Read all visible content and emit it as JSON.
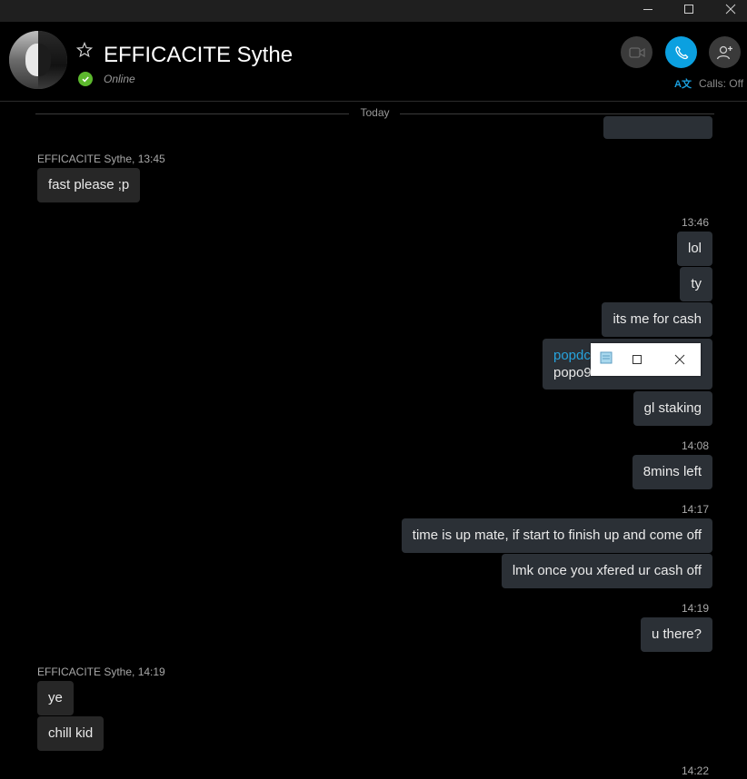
{
  "window": {
    "minimize_icon": "minimize-icon",
    "maximize_icon": "maximize-icon",
    "close_icon": "close-icon"
  },
  "header": {
    "contact_name": "EFFICACITE Sythe",
    "status": "Online",
    "favorite_icon": "star-icon",
    "video_icon": "video-camera-icon",
    "call_icon": "phone-icon",
    "add_people_icon": "add-person-icon",
    "translator_label": "A文",
    "calls_label": "Calls: Off",
    "colors": {
      "call_button": "#0ba0e0",
      "online": "#5cb82d"
    }
  },
  "conversation": {
    "day_divider": "Today",
    "messages": [
      {
        "text": ""
      },
      {
        "sender": "EFFICACITE Sythe, 13:45",
        "text": "fast please ;p"
      },
      {
        "time": "13:46",
        "text": "lol"
      },
      {
        "text": "ty"
      },
      {
        "text": "its me for cash"
      },
      {
        "link": "popdc",
        "text": "popo9"
      },
      {
        "text": "gl staking"
      },
      {
        "time": "14:08",
        "text": "8mins left"
      },
      {
        "time": "14:17",
        "text": "time is up mate, if start to finish up and come off"
      },
      {
        "text": "lmk once you xfered ur cash off"
      },
      {
        "time": "14:19",
        "text": "u there?"
      },
      {
        "sender": "EFFICACITE Sythe, 14:19",
        "text": "ye"
      },
      {
        "text": "chill kid"
      },
      {
        "time": "14:22"
      }
    ]
  }
}
